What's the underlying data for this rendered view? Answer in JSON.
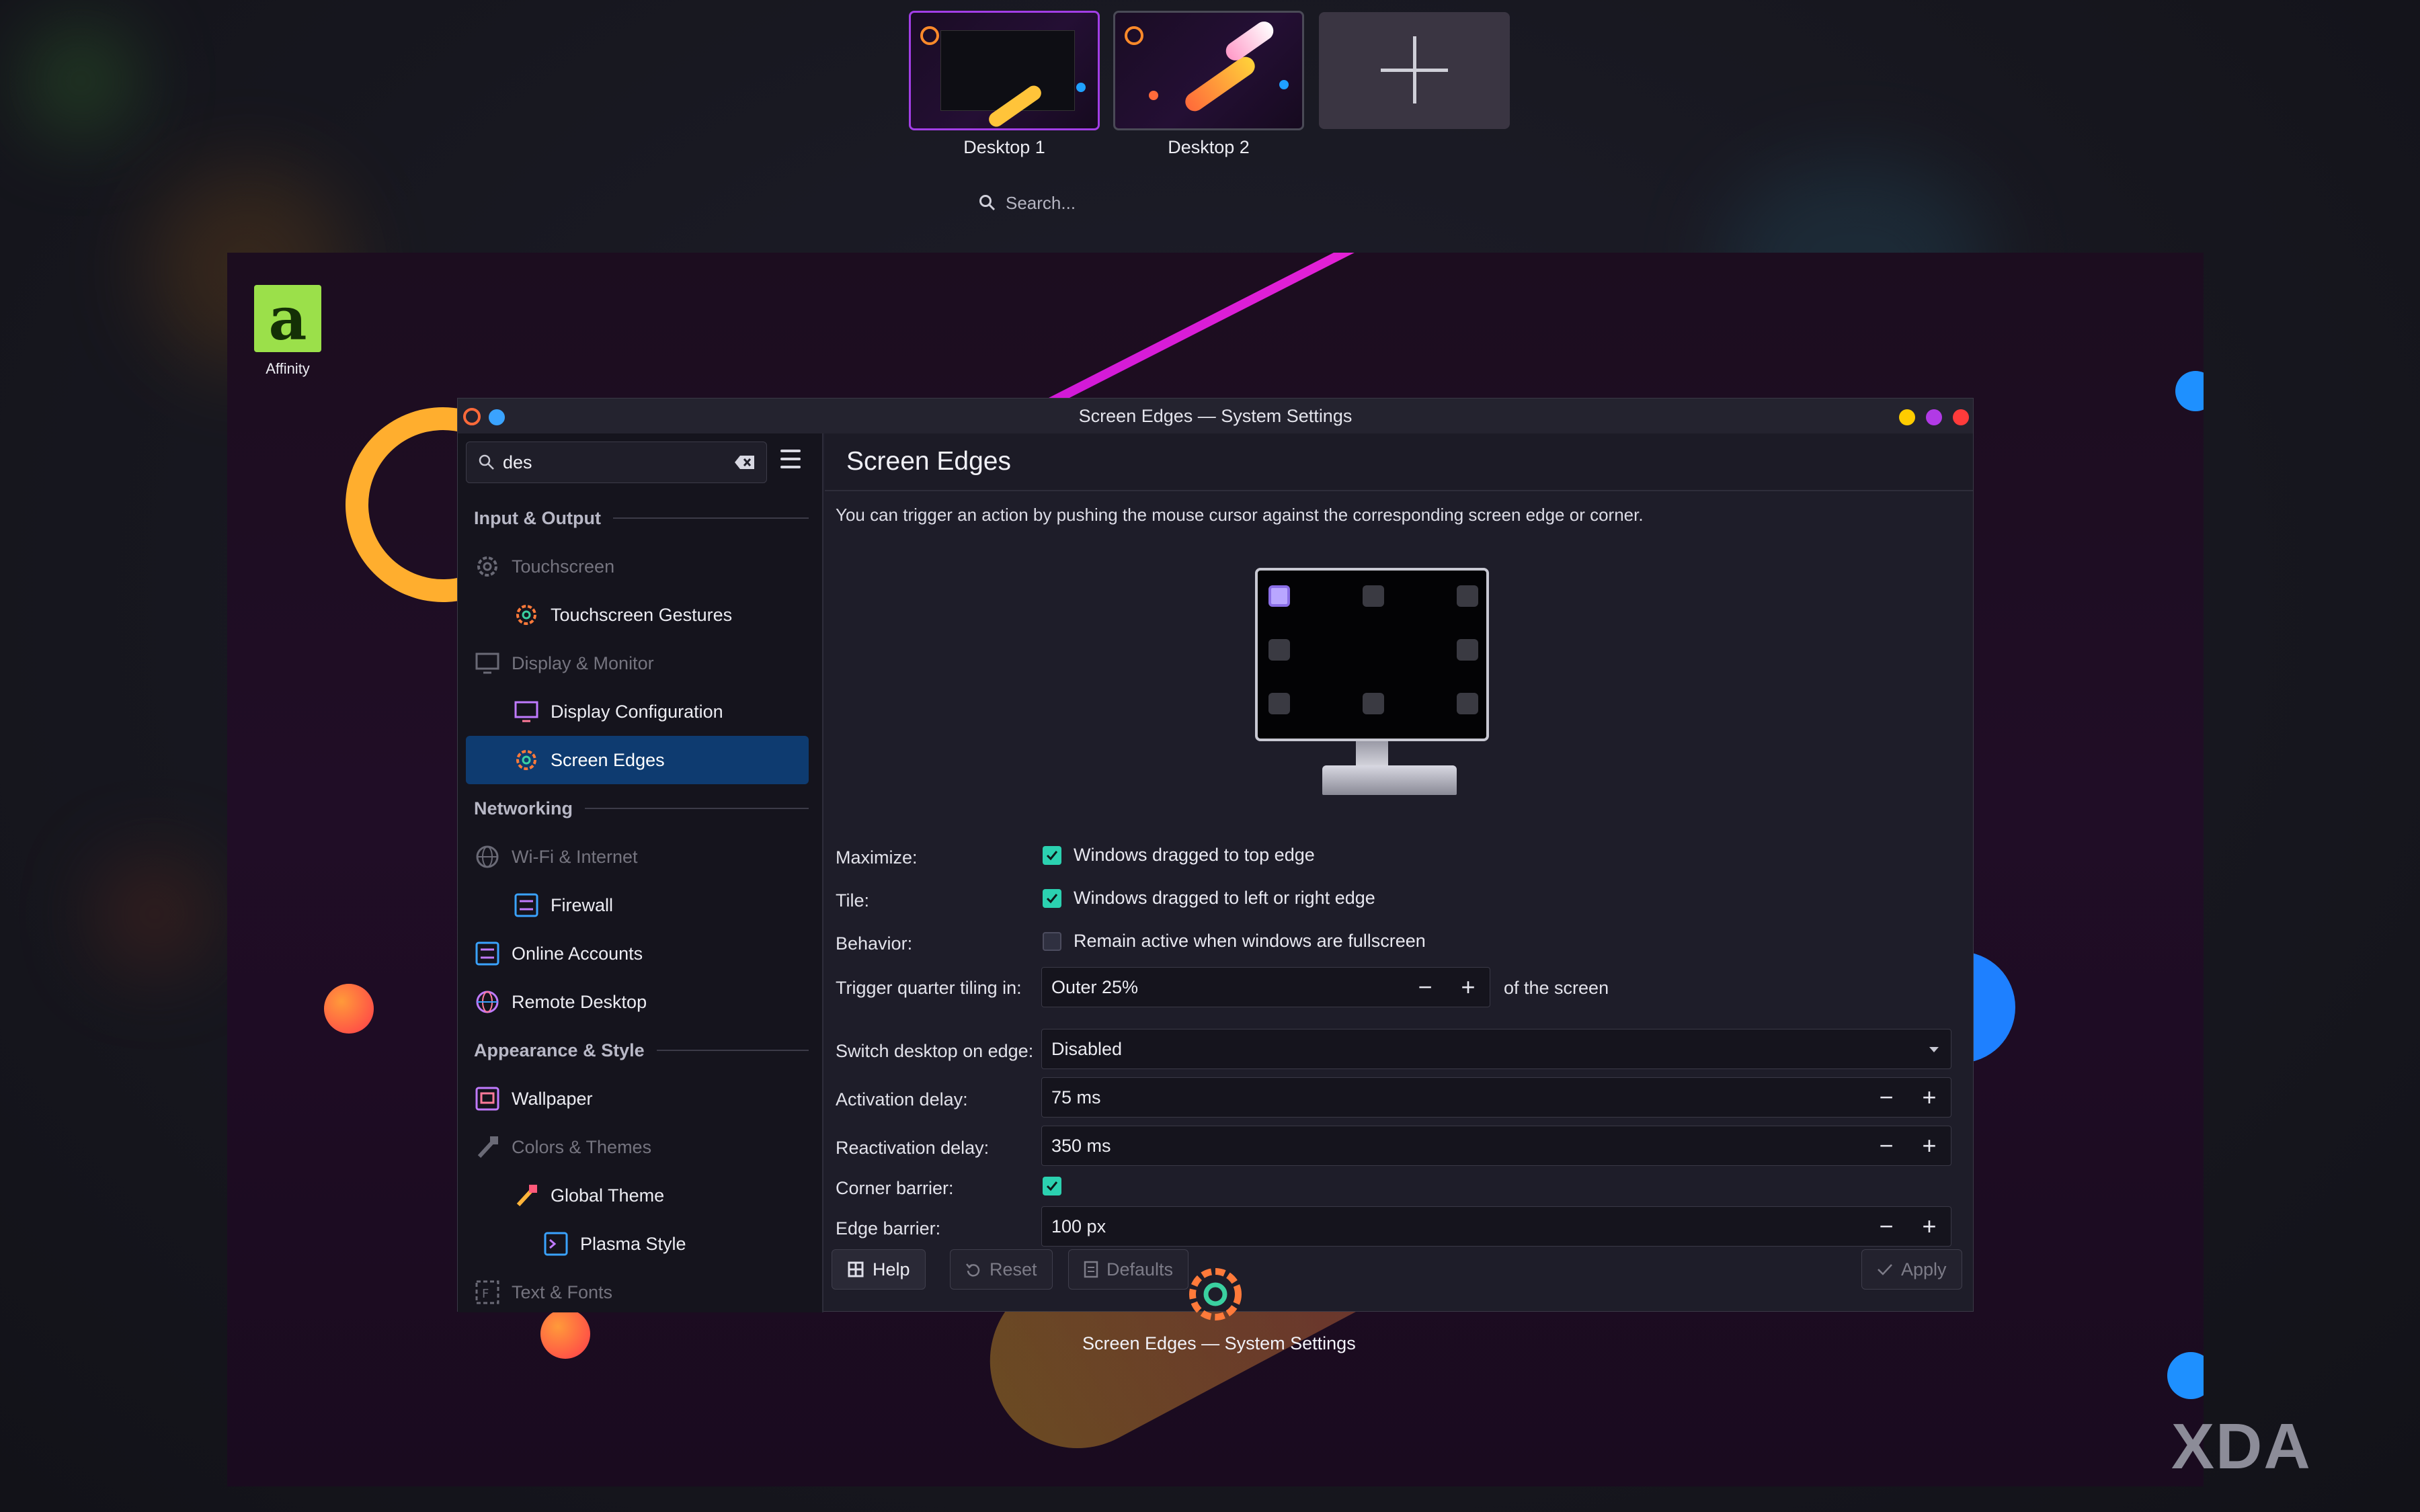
{
  "overview": {
    "desktops": [
      {
        "label": "Desktop 1",
        "active": true
      },
      {
        "label": "Desktop 2",
        "active": false
      }
    ],
    "search_placeholder": "Search..."
  },
  "desktop_icons": [
    {
      "label": "Affinity",
      "glyph": "a",
      "color": "#9be04a"
    }
  ],
  "window": {
    "title": "Screen Edges — System Settings",
    "search_value": "des",
    "page_title": "Screen Edges",
    "description": "You can trigger an action by pushing the mouse cursor against the corresponding screen edge or corner.",
    "nav": {
      "section_input": "Input & Output",
      "touchscreen": "Touchscreen",
      "touchscreen_gestures": "Touchscreen Gestures",
      "display_monitor": "Display & Monitor",
      "display_configuration": "Display Configuration",
      "screen_edges": "Screen Edges",
      "section_networking": "Networking",
      "wifi": "Wi-Fi & Internet",
      "firewall": "Firewall",
      "online_accounts": "Online Accounts",
      "remote_desktop": "Remote Desktop",
      "section_appearance": "Appearance & Style",
      "wallpaper": "Wallpaper",
      "colors_themes": "Colors & Themes",
      "global_theme": "Global Theme",
      "plasma_style": "Plasma Style",
      "text_fonts": "Text & Fonts"
    },
    "form": {
      "maximize_label": "Maximize:",
      "maximize_text": "Windows dragged to top edge",
      "maximize_checked": true,
      "tile_label": "Tile:",
      "tile_text": "Windows dragged to left or right edge",
      "tile_checked": true,
      "behavior_label": "Behavior:",
      "behavior_text": "Remain active when windows are fullscreen",
      "behavior_checked": false,
      "quarter_label": "Trigger quarter tiling in:",
      "quarter_value": "Outer 25%",
      "quarter_suffix": "of the screen",
      "switch_label": "Switch desktop on edge:",
      "switch_value": "Disabled",
      "activation_label": "Activation delay:",
      "activation_value": "75 ms",
      "reactivation_label": "Reactivation delay:",
      "reactivation_value": "350 ms",
      "corner_label": "Corner barrier:",
      "corner_checked": true,
      "edge_label": "Edge barrier:",
      "edge_value": "100 px"
    },
    "buttons": {
      "help": "Help",
      "reset": "Reset",
      "defaults": "Defaults",
      "apply": "Apply"
    }
  },
  "taskbar_tooltip": "Screen Edges — System Settings",
  "watermark": "XDA",
  "colors": {
    "accent": "#2bd1b0",
    "selection": "#0e3b70",
    "active_desktop_border": "#a23ee6"
  }
}
